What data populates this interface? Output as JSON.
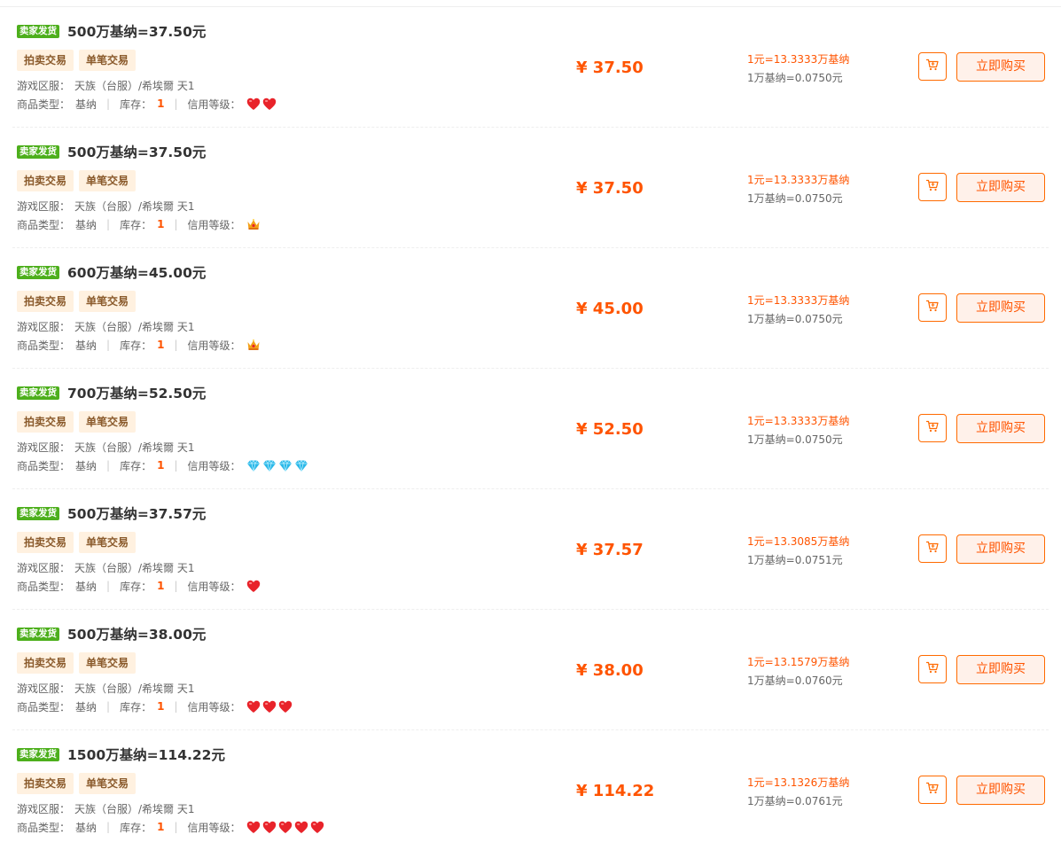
{
  "labels": {
    "seller_badge": "卖家发货",
    "server_label": "游戏区服：",
    "type_label": "商品类型：",
    "stock_label": "库存：",
    "credit_label": "信用等级：",
    "buy_label": "立即购买"
  },
  "icons": {
    "cart": "cart-icon",
    "heart": "heart-icon",
    "crown": "crown-icon",
    "diamond": "diamond-icon"
  },
  "colors": {
    "accent": "#ff5400",
    "badge": "#4daf1c",
    "tag_bg": "#fff1e0",
    "heart": "#e8232a",
    "diamond": "#2ab8e8",
    "crown": "#f4a21b"
  },
  "listings": [
    {
      "title": "500万基纳=37.50元",
      "tags": [
        "拍卖交易",
        "单笔交易"
      ],
      "server": "天族（台服）/希埃爾 天1",
      "type": "基纳",
      "stock": "1",
      "credit": {
        "icon": "heart",
        "count": 2
      },
      "price": "¥ 37.50",
      "rate1": "1元=13.3333万基纳",
      "rate2": "1万基纳=0.0750元"
    },
    {
      "title": "500万基纳=37.50元",
      "tags": [
        "拍卖交易",
        "单笔交易"
      ],
      "server": "天族（台服）/希埃爾 天1",
      "type": "基纳",
      "stock": "1",
      "credit": {
        "icon": "crown",
        "count": 1
      },
      "price": "¥ 37.50",
      "rate1": "1元=13.3333万基纳",
      "rate2": "1万基纳=0.0750元"
    },
    {
      "title": "600万基纳=45.00元",
      "tags": [
        "拍卖交易",
        "单笔交易"
      ],
      "server": "天族（台服）/希埃爾 天1",
      "type": "基纳",
      "stock": "1",
      "credit": {
        "icon": "crown",
        "count": 1
      },
      "price": "¥ 45.00",
      "rate1": "1元=13.3333万基纳",
      "rate2": "1万基纳=0.0750元"
    },
    {
      "title": "700万基纳=52.50元",
      "tags": [
        "拍卖交易",
        "单笔交易"
      ],
      "server": "天族（台服）/希埃爾 天1",
      "type": "基纳",
      "stock": "1",
      "credit": {
        "icon": "diamond",
        "count": 4
      },
      "price": "¥ 52.50",
      "rate1": "1元=13.3333万基纳",
      "rate2": "1万基纳=0.0750元"
    },
    {
      "title": "500万基纳=37.57元",
      "tags": [
        "拍卖交易",
        "单笔交易"
      ],
      "server": "天族（台服）/希埃爾 天1",
      "type": "基纳",
      "stock": "1",
      "credit": {
        "icon": "heart",
        "count": 1
      },
      "price": "¥ 37.57",
      "rate1": "1元=13.3085万基纳",
      "rate2": "1万基纳=0.0751元"
    },
    {
      "title": "500万基纳=38.00元",
      "tags": [
        "拍卖交易",
        "单笔交易"
      ],
      "server": "天族（台服）/希埃爾 天1",
      "type": "基纳",
      "stock": "1",
      "credit": {
        "icon": "heart",
        "count": 3
      },
      "price": "¥ 38.00",
      "rate1": "1元=13.1579万基纳",
      "rate2": "1万基纳=0.0760元"
    },
    {
      "title": "1500万基纳=114.22元",
      "tags": [
        "拍卖交易",
        "单笔交易"
      ],
      "server": "天族（台服）/希埃爾 天1",
      "type": "基纳",
      "stock": "1",
      "credit": {
        "icon": "heart",
        "count": 5
      },
      "price": "¥ 114.22",
      "rate1": "1元=13.1326万基纳",
      "rate2": "1万基纳=0.0761元"
    }
  ]
}
